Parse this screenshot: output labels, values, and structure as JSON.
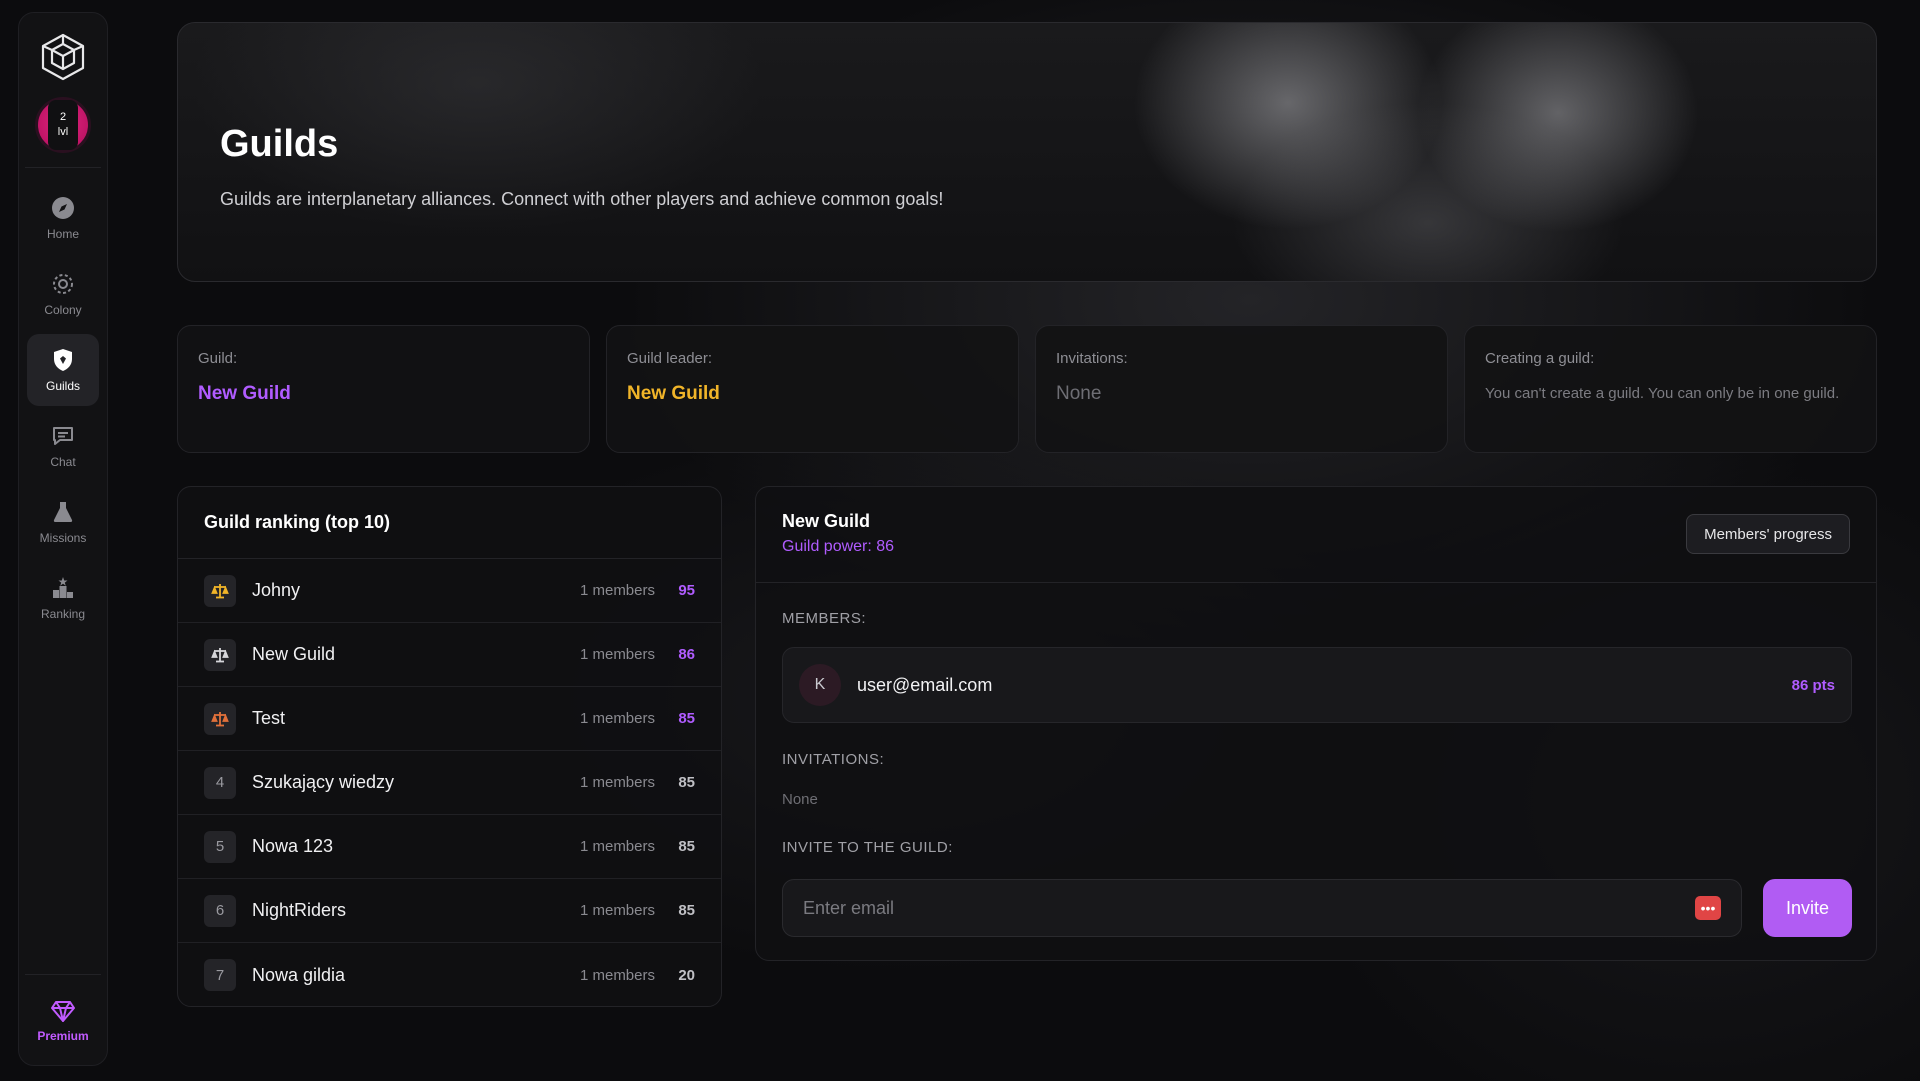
{
  "sidebar": {
    "level": {
      "number": "2",
      "label": "lvl"
    },
    "items": [
      {
        "label": "Home",
        "icon": "compass-icon"
      },
      {
        "label": "Colony",
        "icon": "gear-icon"
      },
      {
        "label": "Guilds",
        "icon": "shield-icon",
        "active": true
      },
      {
        "label": "Chat",
        "icon": "chat-icon"
      },
      {
        "label": "Missions",
        "icon": "flask-icon"
      },
      {
        "label": "Ranking",
        "icon": "podium-icon"
      }
    ],
    "premium_label": "Premium"
  },
  "hero": {
    "title": "Guilds",
    "subtitle": "Guilds are interplanetary alliances. Connect with other players and achieve common goals!"
  },
  "cards": {
    "guild": {
      "label": "Guild:",
      "value": "New Guild"
    },
    "leader": {
      "label": "Guild leader:",
      "value": "New Guild"
    },
    "invitations": {
      "label": "Invitations:",
      "value": "None"
    },
    "creating": {
      "label": "Creating a guild:",
      "text": "You can't create a guild. You can only be in one guild."
    }
  },
  "ranking": {
    "title": "Guild ranking (top 10)",
    "rows": [
      {
        "rank": "1",
        "name": "Johny",
        "members": "1 members",
        "score": "95",
        "medal": "gold"
      },
      {
        "rank": "2",
        "name": "New Guild",
        "members": "1 members",
        "score": "86",
        "medal": "silver"
      },
      {
        "rank": "3",
        "name": "Test",
        "members": "1 members",
        "score": "85",
        "medal": "bronze"
      },
      {
        "rank": "4",
        "name": "Szukający wiedzy",
        "members": "1 members",
        "score": "85"
      },
      {
        "rank": "5",
        "name": "Nowa 123",
        "members": "1 members",
        "score": "85"
      },
      {
        "rank": "6",
        "name": "NightRiders",
        "members": "1 members",
        "score": "85"
      },
      {
        "rank": "7",
        "name": "Nowa gildia",
        "members": "1 members",
        "score": "20"
      }
    ]
  },
  "detail": {
    "title": "New Guild",
    "power": "Guild power: 86",
    "progress_button": "Members' progress",
    "members_label": "MEMBERS:",
    "member": {
      "initial": "K",
      "email": "user@email.com",
      "points": "86 pts"
    },
    "invitations_label": "INVITATIONS:",
    "invitations_value": "None",
    "invite_label": "INVITE TO THE GUILD:",
    "invite_placeholder": "Enter email",
    "invite_button": "Invite"
  },
  "colors": {
    "accent_purple": "#b05cff",
    "gold": "#f0b429",
    "badge_gold": "#f0b429",
    "badge_silver": "#d6d6da",
    "badge_bronze": "#e0703a"
  }
}
